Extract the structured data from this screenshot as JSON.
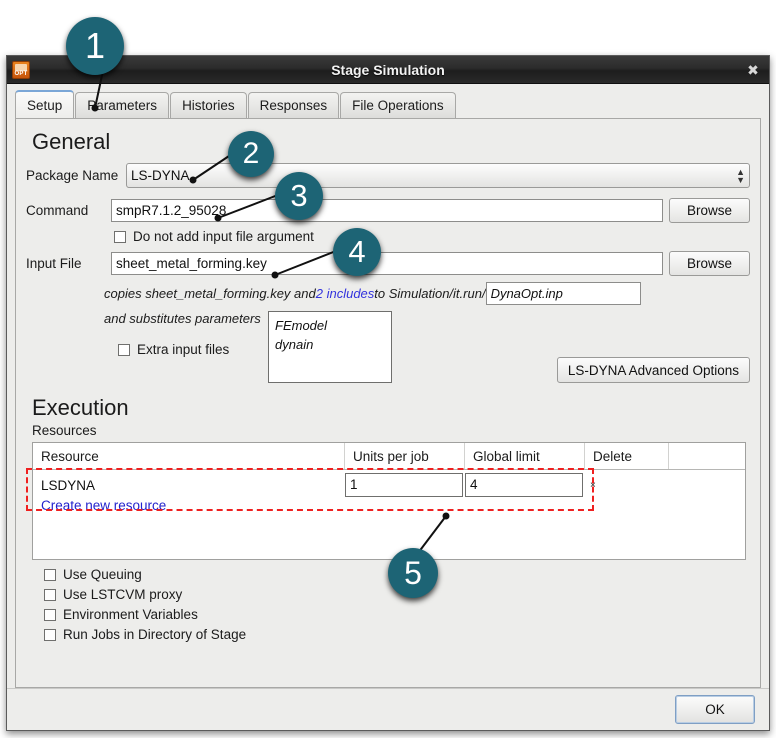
{
  "window": {
    "title": "Stage Simulation",
    "icon": "ls-opt-logo-icon",
    "close_label": "✖"
  },
  "tabs": [
    {
      "label": "Setup",
      "active": true
    },
    {
      "label": "Parameters",
      "active": false
    },
    {
      "label": "Histories",
      "active": false
    },
    {
      "label": "Responses",
      "active": false
    },
    {
      "label": "File Operations",
      "active": false
    }
  ],
  "general": {
    "heading": "General",
    "package_label": "Package Name",
    "package_value": "LS-DYNA",
    "command_label": "Command",
    "command_value": "smpR7.1.2_95028",
    "browse_label": "Browse",
    "no_input_arg_label": "Do not add input file argument",
    "no_input_arg_checked": false,
    "input_file_label": "Input File",
    "input_file_value": "sheet_metal_forming.key",
    "browse2_label": "Browse",
    "copies_prefix": "copies sheet_metal_forming.key and ",
    "copies_link": "2 includes",
    "copies_suffix": " to Simulation/it.run/",
    "dyna_input_value": "DynaOpt.inp",
    "substitutes_text": "and substitutes parameters",
    "extra_input_label": "Extra input files",
    "extra_input_checked": false,
    "include_list": [
      "FEmodel",
      "dynain"
    ],
    "advanced_options_label": "LS-DYNA Advanced Options"
  },
  "execution": {
    "heading": "Execution",
    "resources_label": "Resources",
    "columns": [
      "Resource",
      "Units per job",
      "Global limit",
      "Delete"
    ],
    "rows": [
      {
        "resource": "LSDYNA",
        "units_per_job": "1",
        "global_limit": "4",
        "delete": "×"
      }
    ],
    "create_link": "Create new resource",
    "options": [
      {
        "label": "Use Queuing",
        "checked": false
      },
      {
        "label": "Use LSTCVM proxy",
        "checked": false
      },
      {
        "label": "Environment Variables",
        "checked": false
      },
      {
        "label": "Run Jobs in Directory of Stage",
        "checked": false
      }
    ]
  },
  "footer": {
    "ok_label": "OK"
  },
  "callouts": [
    {
      "number": "1"
    },
    {
      "number": "2"
    },
    {
      "number": "3"
    },
    {
      "number": "4"
    },
    {
      "number": "5"
    }
  ],
  "colors": {
    "badge": "#1d6475",
    "highlight": "#ef2020",
    "link": "#2222cc",
    "window_bg": "#ededeb"
  }
}
